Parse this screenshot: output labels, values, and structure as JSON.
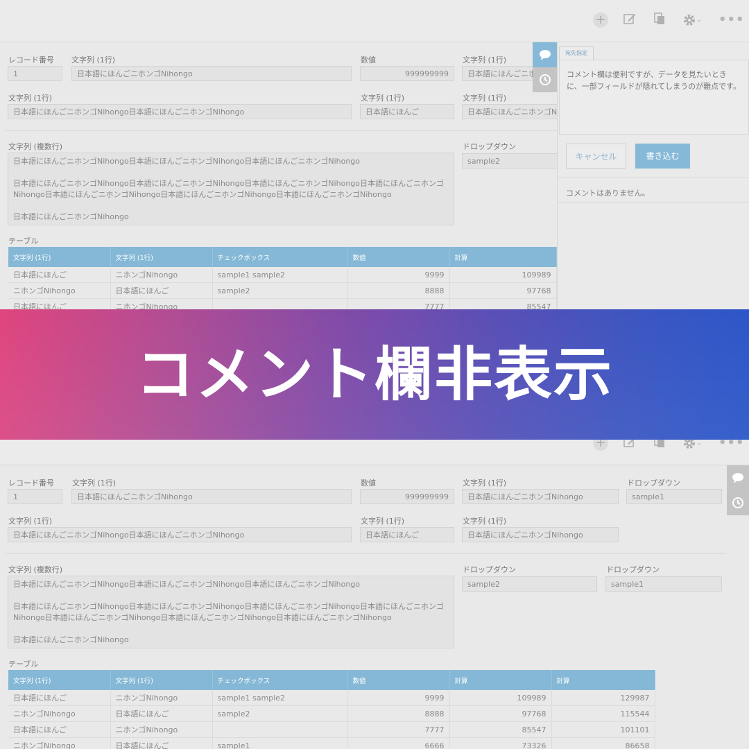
{
  "banner": {
    "title": "コメント欄非表示"
  },
  "top": {
    "fields": {
      "record_label": "レコード番号",
      "record_value": "1",
      "str1_label": "文字列 (1行)",
      "str1_value": "日本語にほんごニホンゴNihongo",
      "num_label": "数値",
      "num_value": "999999999",
      "str2_label": "文字列 (1行)",
      "str2_value": "日本語にほんごニホンゴNihongo",
      "row2_a_label": "文字列 (1行)",
      "row2_a_value": "日本語にほんごニホンゴNihongo日本語にほんごニホンゴNihongo",
      "row2_b_label": "文字列 (1行)",
      "row2_b_value": "日本語にほんご",
      "row2_c_label": "文字列 (1行)",
      "row2_c_value": "日本語にほんごニホンゴNihongo",
      "multi_label": "文字列 (複数行)",
      "multi_lines": [
        "日本語にほんごニホンゴNihongo日本語にほんごニホンゴNihongo日本語にほんごニホンゴNihongo",
        "",
        "日本語にほんごニホンゴNihongo日本語にほんごニホンゴNihongo日本語にほんごニホンゴNihongo日本語にほんごニホンゴ",
        "Nihongo日本語にほんごニホンゴNihongo日本語にほんごニホンゴNihongo日本語にほんごニホンゴNihongo",
        "",
        "日本語にほんごニホンゴNihongo"
      ],
      "dropdown_label": "ドロップダウン",
      "dropdown_value": "sample2"
    },
    "table_label": "テーブル",
    "table_headers": [
      "文字列 (1行)",
      "文字列 (1行)",
      "チェックボックス",
      "数値",
      "計算"
    ],
    "table_rows": [
      [
        "日本語にほんご",
        "ニホンゴNihongo",
        "sample1  sample2",
        "9999",
        "109989"
      ],
      [
        "ニホンゴNihongo",
        "日本語にほんご",
        "sample2",
        "8888",
        "97768"
      ],
      [
        "日本語にほんご",
        "ニホンゴNihongo",
        "",
        "7777",
        "85547"
      ]
    ],
    "comment": {
      "tab_label": "宛先指定",
      "text": "コメント欄は便利ですが、データを見たいときに、一部フィールドが隠れてしまうのが難点です。",
      "cancel_label": "キャンセル",
      "write_label": "書き込む",
      "empty_label": "コメントはありません。"
    }
  },
  "bottom": {
    "fields": {
      "record_label": "レコード番号",
      "record_value": "1",
      "str1_label": "文字列 (1行)",
      "str1_value": "日本語にほんごニホンゴNihongo",
      "num_label": "数値",
      "num_value": "999999999",
      "str2_label": "文字列 (1行)",
      "str2_value": "日本語にほんごニホンゴNihongo",
      "dd1_label": "ドロップダウン",
      "dd1_value": "sample1",
      "row2_a_label": "文字列 (1行)",
      "row2_a_value": "日本語にほんごニホンゴNihongo日本語にほんごニホンゴNihongo",
      "row2_b_label": "文字列 (1行)",
      "row2_b_value": "日本語にほんご",
      "row2_c_label": "文字列 (1行)",
      "row2_c_value": "日本語にほんごニホンゴNihongo",
      "multi_label": "文字列 (複数行)",
      "multi_lines": [
        "日本語にほんごニホンゴNihongo日本語にほんごニホンゴNihongo日本語にほんごニホンゴNihongo",
        "",
        "日本語にほんごニホンゴNihongo日本語にほんごニホンゴNihongo日本語にほんごニホンゴNihongo日本語にほんごニホンゴ",
        "Nihongo日本語にほんごニホンゴNihongo日本語にほんごニホンゴNihongo日本語にほんごニホンゴNihongo",
        "",
        "日本語にほんごニホンゴNihongo"
      ],
      "dd2_label": "ドロップダウン",
      "dd2_value": "sample2",
      "dd3_label": "ドロップダウン",
      "dd3_value": "sample1"
    },
    "table_label": "テーブル",
    "table_headers": [
      "文字列 (1行)",
      "文字列 (1行)",
      "チェックボックス",
      "数値",
      "計算",
      "計算"
    ],
    "table_rows": [
      [
        "日本語にほんご",
        "ニホンゴNihongo",
        "sample1  sample2",
        "9999",
        "109989",
        "129987"
      ],
      [
        "ニホンゴNihongo",
        "日本語にほんご",
        "sample2",
        "8888",
        "97768",
        "115544"
      ],
      [
        "日本語にほんご",
        "ニホンゴNihongo",
        "",
        "7777",
        "85547",
        "101101"
      ],
      [
        "ニホンゴNihongo",
        "日本語にほんご",
        "sample1",
        "6666",
        "73326",
        "86658"
      ]
    ]
  },
  "icons": {
    "add": "plus-icon",
    "edit": "edit-icon",
    "copy": "copy-icon",
    "settings": "gear-icon",
    "more": "more-icon",
    "comment": "comment-icon",
    "history": "history-icon"
  },
  "colors": {
    "table_header": "#85b8d6",
    "side_button_active": "#86b9d8",
    "banner_start": "#e0457e",
    "banner_end": "#2a56c9"
  }
}
